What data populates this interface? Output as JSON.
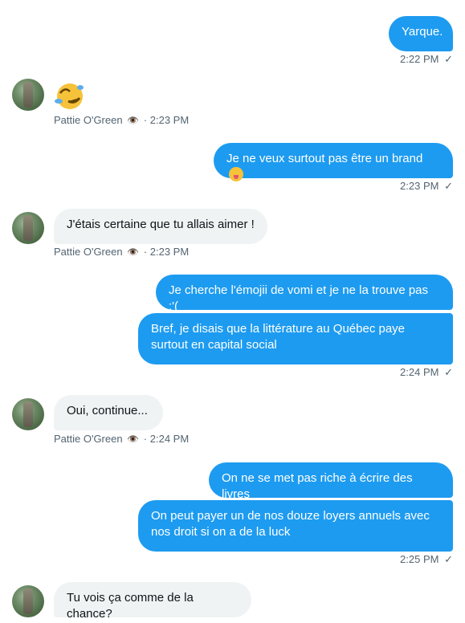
{
  "messages": {
    "m1": {
      "text": "Yarque.",
      "time": "2:22 PM"
    },
    "m2": {
      "sender": "Pattie O'Green",
      "time": "2:23 PM",
      "emoji": "rolling-on-floor-laughing-emoji"
    },
    "m3": {
      "text": "Je ne veux surtout pas être un brand",
      "time": "2:23 PM",
      "emoji": "squinting-tongue-emoji"
    },
    "m4": {
      "text": "J'étais certaine que tu allais aimer !",
      "sender": "Pattie O'Green",
      "time": "2:23 PM"
    },
    "m5": {
      "text": "Je cherche l'émojii de vomi et je ne la trouve pas :'("
    },
    "m6": {
      "text": "Bref, je disais que la littérature au Québec paye surtout en capital social",
      "time": "2:24 PM"
    },
    "m7": {
      "text": "Oui, continue...",
      "sender": "Pattie O'Green",
      "time": "2:24 PM"
    },
    "m8": {
      "text": "On ne se met pas riche à écrire des livres"
    },
    "m9": {
      "text": "On peut payer un de nos douze loyers annuels avec nos droit si on a de la luck",
      "time": "2:25 PM"
    },
    "m10": {
      "text": "Tu vois ça comme de la chance?"
    }
  },
  "sender_suffix": "·",
  "seen_icon": "👁️",
  "sent_check": "✓",
  "colors": {
    "outgoing": "#1d9bf0",
    "incoming": "#eff3f4",
    "meta": "#536471"
  }
}
